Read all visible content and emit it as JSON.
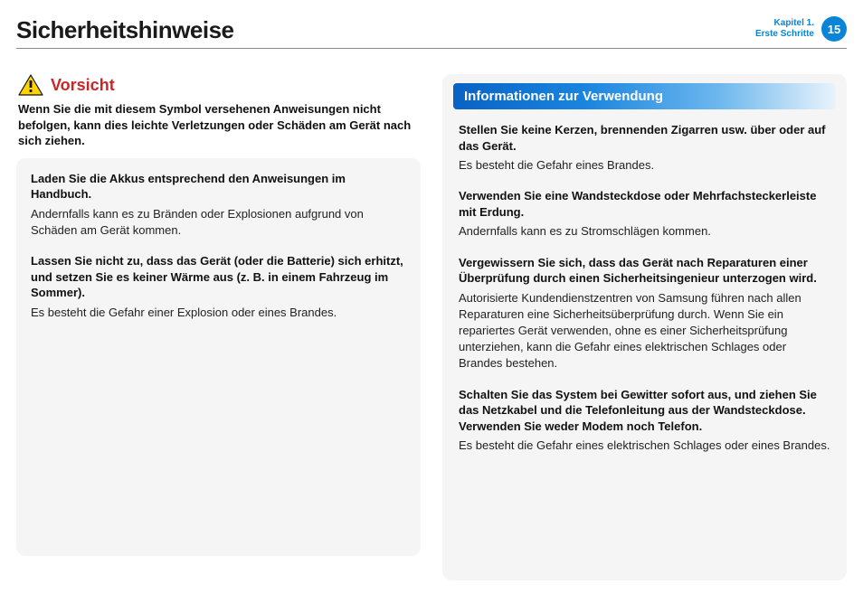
{
  "header": {
    "title": "Sicherheitshinweise",
    "chapter_line1": "Kapitel 1.",
    "chapter_line2": "Erste Schritte",
    "page_number": "15"
  },
  "left": {
    "caution_label": "Vorsicht",
    "caution_desc": "Wenn Sie die mit diesem Symbol versehenen Anweisungen nicht befolgen, kann dies leichte Verletzungen oder Schäden am Gerät nach sich ziehen.",
    "items": [
      {
        "h": "Laden Sie die Akkus entsprechend den Anweisungen im Handbuch.",
        "b": "Andernfalls kann es zu Bränden oder Explosionen aufgrund von Schäden am Gerät kommen."
      },
      {
        "h": "Lassen Sie nicht zu, dass das Gerät (oder die Batterie) sich erhitzt, und setzen Sie es keiner Wärme aus (z. B. in einem Fahrzeug im Sommer).",
        "b": "Es besteht die Gefahr einer Explosion oder eines Brandes."
      }
    ]
  },
  "right": {
    "section_heading": "Informationen zur Verwendung",
    "items": [
      {
        "h": "Stellen Sie keine Kerzen, brennenden Zigarren usw. über oder auf das Gerät.",
        "b": "Es besteht die Gefahr eines Brandes."
      },
      {
        "h": "Verwenden Sie eine Wandsteckdose oder Mehrfachsteckerleiste mit Erdung.",
        "b": "Andernfalls kann es zu Stromschlägen kommen."
      },
      {
        "h": "Vergewissern Sie sich, dass das Gerät nach Reparaturen einer Überprüfung durch einen Sicherheitsingenieur unterzogen wird.",
        "b": "Autorisierte Kundendienstzentren von Samsung führen nach allen Reparaturen eine Sicherheitsüberprüfung durch. Wenn Sie ein repariertes Gerät verwenden, ohne es einer Sicherheitsprüfung unterziehen, kann die Gefahr eines elektrischen Schlages oder Brandes bestehen."
      },
      {
        "h": "Schalten Sie das System bei Gewitter sofort aus, und ziehen Sie das Netzkabel und die Telefonleitung aus der Wandsteckdose. Verwenden Sie weder Modem noch Telefon.",
        "b": "Es besteht die Gefahr eines elektrischen Schlages oder eines Brandes."
      }
    ]
  }
}
